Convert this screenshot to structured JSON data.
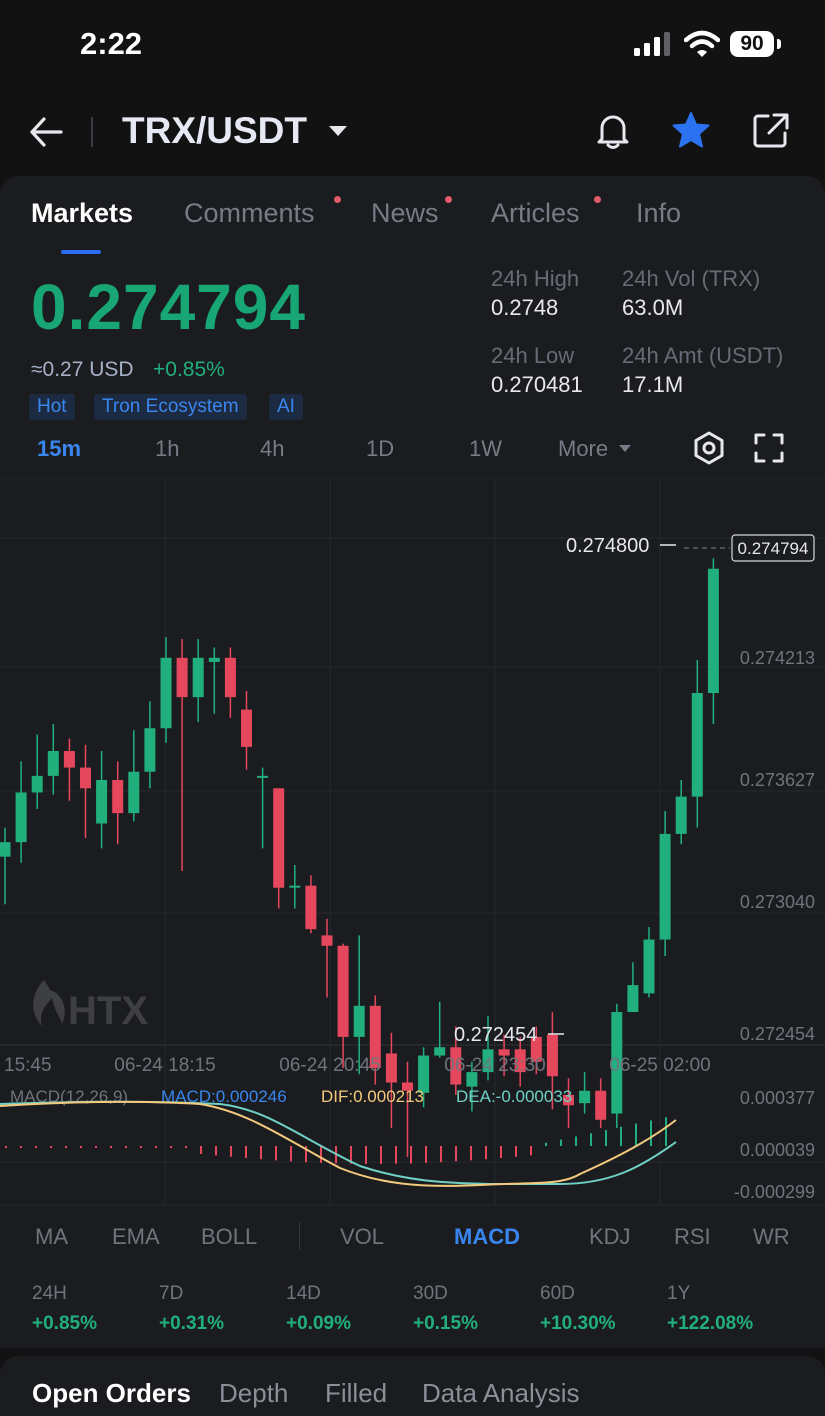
{
  "status": {
    "time": "2:22",
    "battery": "90"
  },
  "header": {
    "pair": "TRX/USDT"
  },
  "tabs": [
    {
      "label": "Markets",
      "active": true,
      "dot": false
    },
    {
      "label": "Comments",
      "dot": true
    },
    {
      "label": "News",
      "dot": true
    },
    {
      "label": "Articles",
      "dot": true
    },
    {
      "label": "Info",
      "dot": false
    }
  ],
  "ticker": {
    "price": "0.274794",
    "usd_equiv": "≈0.27 USD",
    "change_24h": "+0.85%",
    "tags": [
      "Hot",
      "Tron Ecosystem",
      "AI"
    ],
    "stats": {
      "high_label": "24h High",
      "high_value": "0.2748",
      "vol_label": "24h Vol (TRX)",
      "vol_value": "63.0M",
      "low_label": "24h Low",
      "low_value": "0.270481",
      "amt_label": "24h Amt (USDT)",
      "amt_value": "17.1M"
    }
  },
  "timeframes": {
    "items": [
      "15m",
      "1h",
      "4h",
      "1D",
      "1W"
    ],
    "more": "More",
    "active": "15m"
  },
  "colors": {
    "up": "#21b07d",
    "down": "#e5475c",
    "accent": "#2b6df0"
  },
  "chart_data": {
    "type": "candlestick",
    "watermark": "HTX",
    "last_price_label": "0.274794",
    "high_marker": "0.274800",
    "low_marker": "0.272454",
    "y_tick_labels": [
      "0.274213",
      "0.273627",
      "0.273040",
      "0.272454"
    ],
    "x_tick_labels": [
      "15:45",
      "06-24 18:15",
      "06-24 20:45",
      "06-24 23:30",
      "06-25 02:00"
    ],
    "ylim": [
      0.272454,
      0.2748
    ],
    "candles": [
      [
        0.27331,
        0.27338,
        0.27345,
        0.27308
      ],
      [
        0.27338,
        0.27362,
        0.27377,
        0.27328
      ],
      [
        0.27362,
        0.2737,
        0.2739,
        0.27354
      ],
      [
        0.2737,
        0.27382,
        0.27395,
        0.27361
      ],
      [
        0.27382,
        0.27374,
        0.27388,
        0.27358
      ],
      [
        0.27374,
        0.27364,
        0.27385,
        0.2734
      ],
      [
        0.27347,
        0.27368,
        0.27382,
        0.27335
      ],
      [
        0.27368,
        0.27352,
        0.27377,
        0.27337
      ],
      [
        0.27352,
        0.27372,
        0.27392,
        0.27348
      ],
      [
        0.27372,
        0.27393,
        0.27406,
        0.27364
      ],
      [
        0.27393,
        0.27427,
        0.27437,
        0.27386
      ],
      [
        0.27427,
        0.27408,
        0.27436,
        0.27324
      ],
      [
        0.27408,
        0.27427,
        0.27436,
        0.27396
      ],
      [
        0.27425,
        0.27427,
        0.27432,
        0.274
      ],
      [
        0.27427,
        0.27408,
        0.27432,
        0.27398
      ],
      [
        0.27402,
        0.27384,
        0.27411,
        0.27373
      ],
      [
        0.2737,
        0.2737,
        0.27374,
        0.27335
      ],
      [
        0.27364,
        0.27316,
        0.27364,
        0.27306
      ],
      [
        0.27317,
        0.27317,
        0.27327,
        0.27306
      ],
      [
        0.27317,
        0.27296,
        0.27322,
        0.27294
      ],
      [
        0.27293,
        0.27288,
        0.27301,
        0.27263
      ],
      [
        0.27288,
        0.27244,
        0.27289,
        0.27229
      ],
      [
        0.27244,
        0.27259,
        0.27293,
        0.27226
      ],
      [
        0.27259,
        0.27229,
        0.27264,
        0.27221
      ],
      [
        0.27236,
        0.27222,
        0.27246,
        0.272
      ],
      [
        0.27222,
        0.27218,
        0.27232,
        0.27186
      ],
      [
        0.27217,
        0.27235,
        0.27239,
        0.2721
      ],
      [
        0.27235,
        0.27239,
        0.27261,
        0.27234
      ],
      [
        0.27239,
        0.27221,
        0.27249,
        0.27216
      ],
      [
        0.2722,
        0.27227,
        0.27232,
        0.27208
      ],
      [
        0.27227,
        0.27238,
        0.27254,
        0.27223
      ],
      [
        0.27238,
        0.27235,
        0.27245,
        0.27225
      ],
      [
        0.27238,
        0.27227,
        0.27244,
        0.2722
      ],
      [
        0.27244,
        0.27232,
        0.27249,
        0.27226
      ],
      [
        0.27245,
        0.27225,
        0.27256,
        0.27209
      ],
      [
        0.27216,
        0.27211,
        0.27224,
        0.272
      ],
      [
        0.27212,
        0.27218,
        0.27227,
        0.27207
      ],
      [
        0.27218,
        0.27204,
        0.27224,
        0.272
      ],
      [
        0.27207,
        0.27256,
        0.2726,
        0.272
      ],
      [
        0.27256,
        0.27269,
        0.2728,
        0.27261
      ],
      [
        0.27265,
        0.27291,
        0.27297,
        0.27263
      ],
      [
        0.27291,
        0.27342,
        0.27353,
        0.27283
      ],
      [
        0.27342,
        0.2736,
        0.27368,
        0.27337
      ],
      [
        0.2736,
        0.2741,
        0.27426,
        0.27345
      ],
      [
        0.2741,
        0.2747,
        0.27475,
        0.27395
      ]
    ]
  },
  "macd": {
    "label": "MACD(12,26,9)",
    "macd_value": "MACD:0.000246",
    "dif_value": "DIF:0.000213",
    "dea_value": "DEA:-0.000033",
    "y_ticks": [
      "0.000377",
      "0.000039",
      "-0.000299"
    ]
  },
  "indicators": {
    "items": [
      "MA",
      "EMA",
      "BOLL",
      "VOL",
      "MACD",
      "KDJ",
      "RSI",
      "WR"
    ],
    "active": "MACD"
  },
  "performance": [
    {
      "label": "24H",
      "value": "+0.85%"
    },
    {
      "label": "7D",
      "value": "+0.31%"
    },
    {
      "label": "14D",
      "value": "+0.09%"
    },
    {
      "label": "30D",
      "value": "+0.15%"
    },
    {
      "label": "60D",
      "value": "+10.30%"
    },
    {
      "label": "1Y",
      "value": "+122.08%"
    }
  ],
  "bottom_tabs": [
    "Open Orders",
    "Depth",
    "Filled",
    "Data Analysis"
  ]
}
